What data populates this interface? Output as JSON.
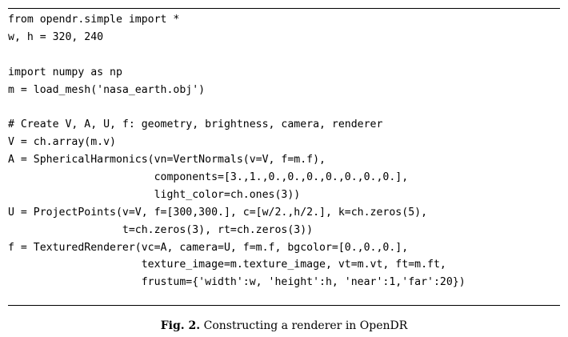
{
  "code_lines": [
    "from opendr.simple import *",
    "w, h = 320, 240",
    "",
    "import numpy as np",
    "m = load_mesh('nasa_earth.obj')",
    "",
    "# Create V, A, U, f: geometry, brightness, camera, renderer",
    "V = ch.array(m.v)",
    "A = SphericalHarmonics(vn=VertNormals(v=V, f=m.f),",
    "                       components=[3.,1.,0.,0.,0.,0.,0.,0.,0.],",
    "                       light_color=ch.ones(3))",
    "U = ProjectPoints(v=V, f=[300,300.], c=[w/2.,h/2.], k=ch.zeros(5),",
    "                  t=ch.zeros(3), rt=ch.zeros(3))",
    "f = TexturedRenderer(vc=A, camera=U, f=m.f, bgcolor=[0.,0.,0.],",
    "                     texture_image=m.texture_image, vt=m.vt, ft=m.ft,",
    "                     frustum={'width':w, 'height':h, 'near':1,'far':20})"
  ],
  "caption": {
    "label": "Fig. 2.",
    "text": " Constructing a renderer in OpenDR"
  }
}
